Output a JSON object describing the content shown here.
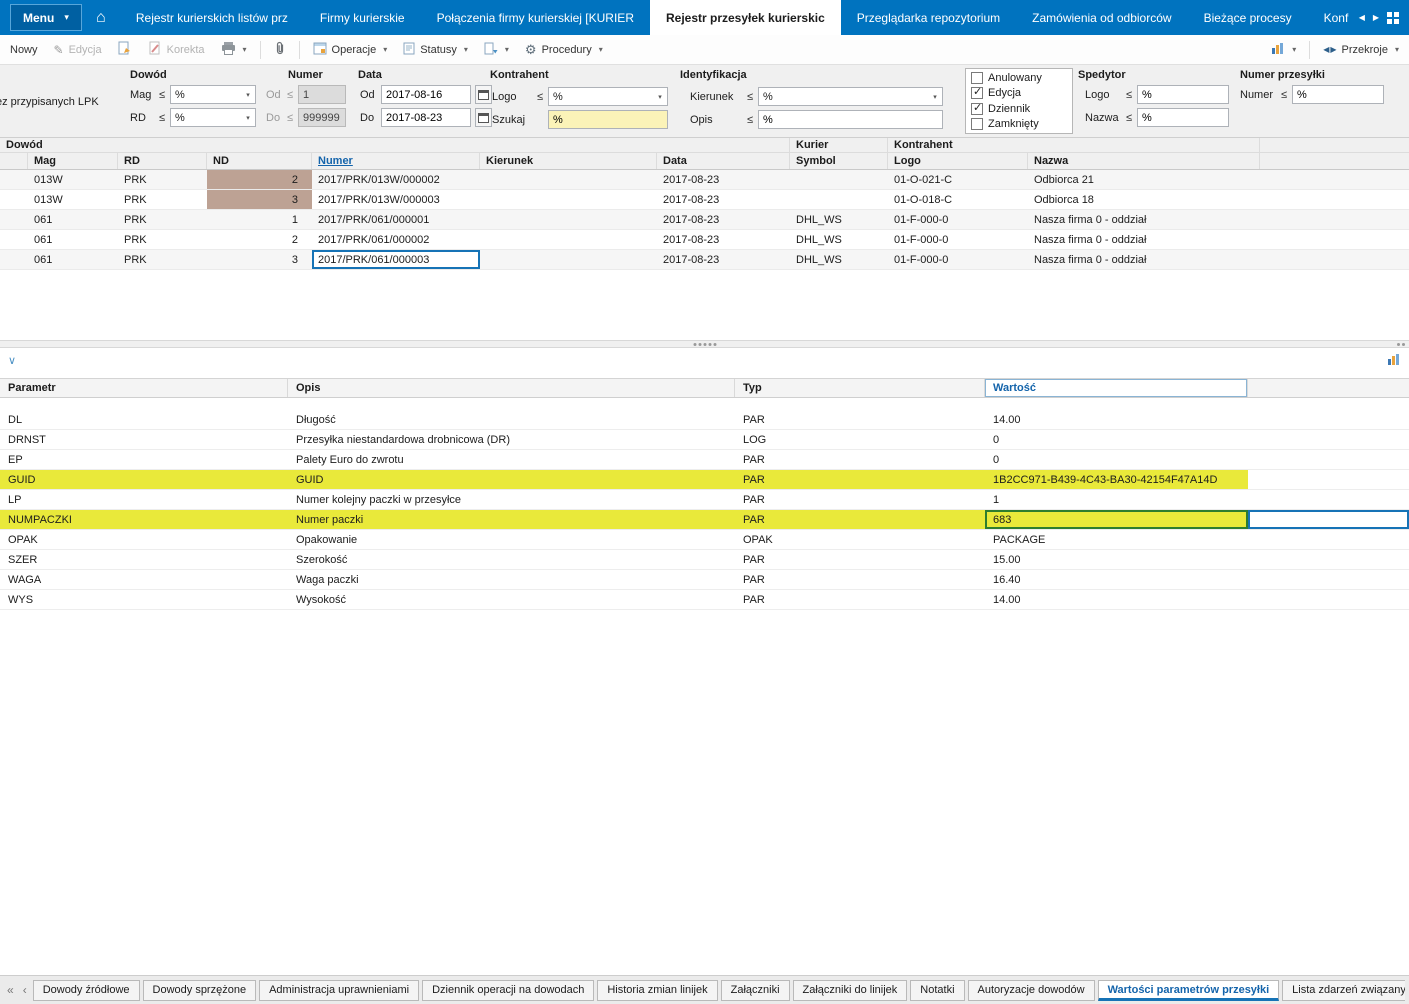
{
  "colors": {
    "topbar_blue": "#0073bf",
    "highlight_yellow": "#e9e93a",
    "nd_highlight_brown": "#bda294",
    "selection_blue": "#1673b6",
    "edit_green": "#2e7d2e",
    "link_blue": "#1464ab",
    "search_yellow": "#fbf3b8"
  },
  "icons": {
    "caret": "▾",
    "home": "⌂",
    "tri_left": "◀",
    "tri_right": "▶",
    "pencil": "✎",
    "gear": "⚙",
    "collapse": "∨",
    "chevron_double_left": "«",
    "chevron_left": "‹"
  },
  "topbar": {
    "menu_label": "Menu",
    "tabs": [
      {
        "label": "Rejestr kurierskich listów prz"
      },
      {
        "label": "Firmy kurierskie"
      },
      {
        "label": "Połączenia firmy kurierskiej [KURIER"
      },
      {
        "label": "Rejestr przesyłek kurierskic"
      },
      {
        "label": "Przeglądarka repozytorium"
      },
      {
        "label": "Zamówienia od odbiorców"
      },
      {
        "label": "Bieżące procesy"
      },
      {
        "label": "Konfiguracja"
      }
    ]
  },
  "toolbar": {
    "nowy": "Nowy",
    "edycja": "Edycja",
    "korekta": "Korekta",
    "operacje": "Operacje",
    "statusy": "Statusy",
    "procedury": "Procedury",
    "przekroje": "Przekroje"
  },
  "filters": {
    "left_label": "ez przypisanych LPK",
    "op": "≤",
    "dowod_title": "Dowód",
    "mag_label": "Mag",
    "mag_value": "%",
    "rd_label": "RD",
    "rd_value": "%",
    "numer_title": "Numer",
    "numer_od_label": "Od",
    "numer_od_value": "1",
    "numer_do_label": "Do",
    "numer_do_value": "999999",
    "data_title": "Data",
    "data_od_label": "Od",
    "data_od_value": "2017-08-16",
    "data_do_label": "Do",
    "data_do_value": "2017-08-23",
    "kontrahent_title": "Kontrahent",
    "logo_label": "Logo",
    "logo_value": "%",
    "szukaj_label": "Szukaj",
    "szukaj_value": "%",
    "identyfikacja_title": "Identyfikacja",
    "kierunek_label": "Kierunek",
    "kierunek_value": "%",
    "opis_label": "Opis",
    "opis_value": "%",
    "flags": [
      {
        "label": "Anulowany",
        "checked": false
      },
      {
        "label": "Edycja",
        "checked": true
      },
      {
        "label": "Dziennik",
        "checked": true
      },
      {
        "label": "Zamknięty",
        "checked": false
      }
    ],
    "spedytor_title": "Spedytor",
    "sp_logo_label": "Logo",
    "sp_logo_value": "%",
    "sp_nazwa_label": "Nazwa",
    "sp_nazwa_value": "%",
    "przesylka_title": "Numer przesyłki",
    "przesylka_numer_label": "Numer",
    "przesylka_numer_value": "%"
  },
  "shipments": {
    "groups": {
      "dowod": "Dowód",
      "kurier": "Kurier",
      "kontrahent": "Kontrahent"
    },
    "cols": {
      "mag": "Mag",
      "rd": "RD",
      "nd": "ND",
      "numer": "Numer",
      "kierunek": "Kierunek",
      "data": "Data",
      "symbol": "Symbol",
      "logo": "Logo",
      "nazwa": "Nazwa"
    },
    "rows": [
      {
        "mag": "013W",
        "rd": "PRK",
        "nd": "2",
        "numer": "2017/PRK/013W/000002",
        "data": "2017-08-23",
        "symbol": "",
        "logo": "01-O-021-C",
        "nazwa": "Odbiorca 21"
      },
      {
        "mag": "013W",
        "rd": "PRK",
        "nd": "3",
        "numer": "2017/PRK/013W/000003",
        "data": "2017-08-23",
        "symbol": "",
        "logo": "01-O-018-C",
        "nazwa": "Odbiorca 18"
      },
      {
        "mag": "061",
        "rd": "PRK",
        "nd": "1",
        "numer": "2017/PRK/061/000001",
        "data": "2017-08-23",
        "symbol": "DHL_WS",
        "logo": "01-F-000-0",
        "nazwa": "Nasza firma 0 - oddział"
      },
      {
        "mag": "061",
        "rd": "PRK",
        "nd": "2",
        "numer": "2017/PRK/061/000002",
        "data": "2017-08-23",
        "symbol": "DHL_WS",
        "logo": "01-F-000-0",
        "nazwa": "Nasza firma 0 - oddział"
      },
      {
        "mag": "061",
        "rd": "PRK",
        "nd": "3",
        "numer": "2017/PRK/061/000003",
        "data": "2017-08-23",
        "symbol": "DHL_WS",
        "logo": "01-F-000-0",
        "nazwa": "Nasza firma 0 - oddział"
      }
    ]
  },
  "params": {
    "cols": {
      "parametr": "Parametr",
      "opis": "Opis",
      "typ": "Typ",
      "wartosc": "Wartość"
    },
    "rows": [
      {
        "parametr": "DL",
        "opis": "Długość",
        "typ": "PAR",
        "wartosc": "14.00"
      },
      {
        "parametr": "DRNST",
        "opis": "Przesyłka niestandardowa drobnicowa (DR)",
        "typ": "LOG",
        "wartosc": "0"
      },
      {
        "parametr": "EP",
        "opis": "Palety Euro do zwrotu",
        "typ": "PAR",
        "wartosc": "0"
      },
      {
        "parametr": "GUID",
        "opis": "GUID",
        "typ": "PAR",
        "wartosc": "1B2CC971-B439-4C43-BA30-42154F47A14D"
      },
      {
        "parametr": "LP",
        "opis": "Numer kolejny paczki w przesyłce",
        "typ": "PAR",
        "wartosc": "1"
      },
      {
        "parametr": "NUMPACZKI",
        "opis": "Numer paczki",
        "typ": "PAR",
        "wartosc": "683"
      },
      {
        "parametr": "OPAK",
        "opis": "Opakowanie",
        "typ": "OPAK",
        "wartosc": "PACKAGE"
      },
      {
        "parametr": "SZER",
        "opis": "Szerokość",
        "typ": "PAR",
        "wartosc": "15.00"
      },
      {
        "parametr": "WAGA",
        "opis": "Waga paczki",
        "typ": "PAR",
        "wartosc": "16.40"
      },
      {
        "parametr": "WYS",
        "opis": "Wysokość",
        "typ": "PAR",
        "wartosc": "14.00"
      }
    ]
  },
  "bottom_tabs": [
    {
      "label": "Dowody źródłowe"
    },
    {
      "label": "Dowody sprzężone"
    },
    {
      "label": "Administracja uprawnieniami"
    },
    {
      "label": "Dziennik operacji na dowodach"
    },
    {
      "label": "Historia zmian linijek"
    },
    {
      "label": "Załączniki"
    },
    {
      "label": "Załączniki do linijek"
    },
    {
      "label": "Notatki"
    },
    {
      "label": "Autoryzacje dowodów"
    },
    {
      "label": "Wartości parametrów przesyłki"
    },
    {
      "label": "Lista zdarzeń związanych z"
    }
  ]
}
